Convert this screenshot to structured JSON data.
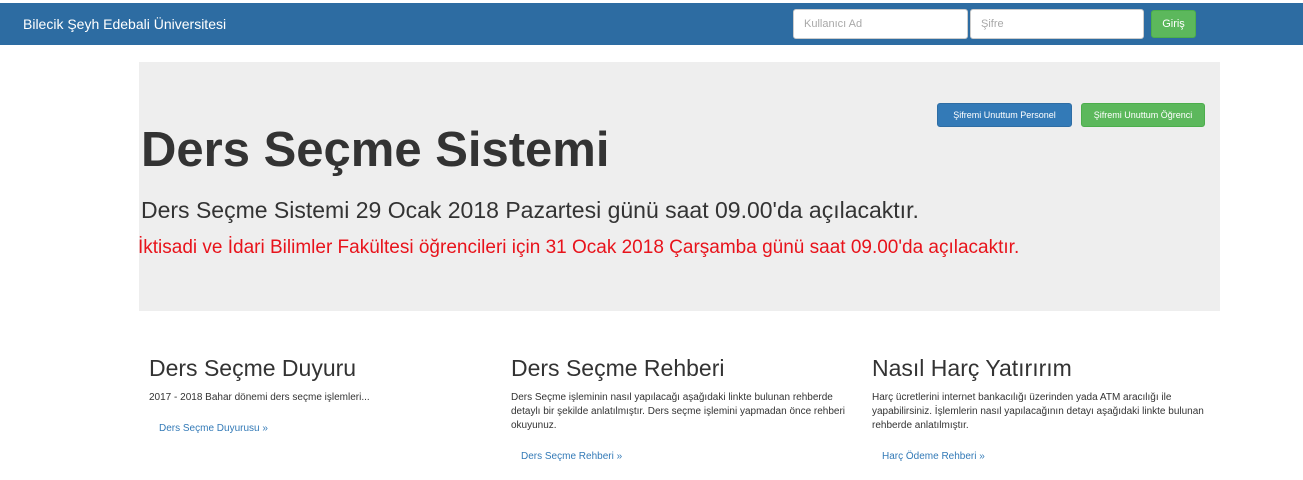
{
  "navbar": {
    "brand": "Bilecik Şeyh Edebali Üniversitesi",
    "username_placeholder": "Kullanıcı Ad",
    "password_placeholder": "Şifre",
    "login_label": "Giriş"
  },
  "jumbotron": {
    "forgot_staff_label": "Şifremi Unuttum Personel",
    "forgot_student_label": "Şifremi Unuttum Öğrenci",
    "title": "Ders Seçme Sistemi",
    "line1": "Ders Seçme Sistemi 29 Ocak 2018 Pazartesi günü saat 09.00'da açılacaktır.",
    "line2": "İktisadi ve İdari Bilimler Fakültesi öğrencileri için 31 Ocak 2018 Çarşamba günü saat 09.00'da açılacaktır."
  },
  "columns": [
    {
      "heading": "Ders Seçme Duyuru",
      "text": "2017 - 2018 Bahar dönemi ders seçme işlemleri...",
      "link": "Ders Seçme Duyurusu »"
    },
    {
      "heading": "Ders Seçme Rehberi",
      "text": "Ders Seçme işleminin nasıl yapılacağı aşağıdaki linkte bulunan rehberde detaylı bir şekilde anlatılmıştır. Ders seçme işlemini yapmadan önce rehberi okuyunuz.",
      "link": "Ders Seçme Rehberi »"
    },
    {
      "heading": "Nasıl Harç Yatırırım",
      "text": "Harç ücretlerini internet bankacılığı üzerinden yada ATM aracılığı ile yapabilirsiniz. İşlemlerin nasıl yapılacağının detayı aşağıdaki linkte bulunan rehberde anlatılmıştır.",
      "link": "Harç Ödeme Rehberi »"
    }
  ],
  "colors": {
    "navbar": "#2d6ca2",
    "success": "#5cb85c",
    "primary": "#337ab7",
    "alert_text": "#e8131b",
    "jumbotron_bg": "#eeeeee"
  }
}
